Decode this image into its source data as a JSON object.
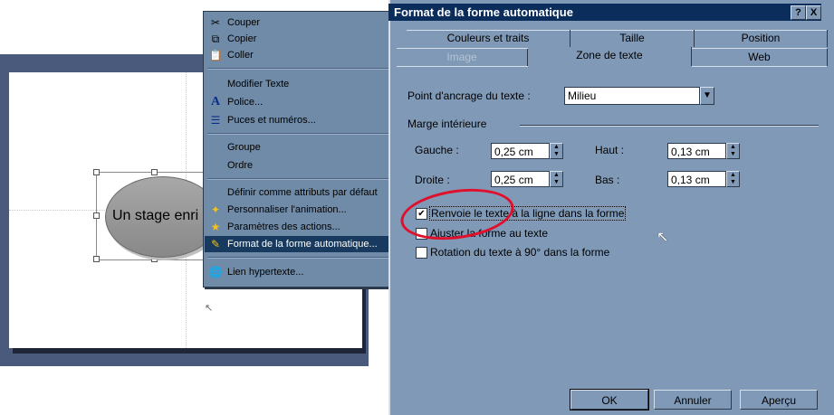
{
  "slide": {
    "shape_text": "Un stage enri"
  },
  "context_menu": {
    "items": [
      {
        "icon": "scissors-icon",
        "glyph": "✂",
        "label": "Couper"
      },
      {
        "icon": "copy-icon",
        "glyph": "⧉",
        "label": "Copier"
      },
      {
        "icon": "paste-icon",
        "glyph": "📋",
        "label": "Coller"
      },
      {
        "icon": "",
        "glyph": "",
        "label": "Modifier Texte"
      },
      {
        "icon": "font-icon",
        "glyph": "A",
        "label": "Police..."
      },
      {
        "icon": "bullets-icon",
        "glyph": "☰",
        "label": "Puces et numéros..."
      },
      {
        "icon": "",
        "glyph": "",
        "label": "Groupe"
      },
      {
        "icon": "",
        "glyph": "",
        "label": "Ordre"
      },
      {
        "icon": "",
        "glyph": "",
        "label": "Définir comme attributs par défaut"
      },
      {
        "icon": "animation-icon",
        "glyph": "✦",
        "label": "Personnaliser l'animation..."
      },
      {
        "icon": "actions-icon",
        "glyph": "★",
        "label": "Paramètres des actions..."
      },
      {
        "icon": "format-shape-icon",
        "glyph": "✎",
        "label": "Format de la forme automatique..."
      },
      {
        "icon": "hyperlink-icon",
        "glyph": "🌐",
        "label": "Lien hypertexte..."
      }
    ]
  },
  "dialog": {
    "title": "Format de la forme automatique",
    "help_label": "?",
    "close_label": "X",
    "tabs": {
      "row1": [
        "Couleurs et traits",
        "Taille",
        "Position"
      ],
      "row2": [
        "Image",
        "Zone de texte",
        "Web"
      ]
    },
    "anchor_label": "Point d'ancrage du texte :",
    "anchor_value": "Milieu",
    "margin_group": "Marge intérieure",
    "left_label": "Gauche :",
    "left_value": "0,25 cm",
    "top_label": "Haut :",
    "top_value": "0,13 cm",
    "right_label": "Droite :",
    "right_value": "0,25 cm",
    "bottom_label": "Bas :",
    "bottom_value": "0,13 cm",
    "checkboxes": [
      {
        "label": "Renvoie le texte à la ligne dans la forme",
        "checked": true
      },
      {
        "label": "Ajuster la forme au texte",
        "checked": false
      },
      {
        "label": "Rotation du texte à 90° dans la forme",
        "checked": false
      }
    ],
    "ok_label": "OK",
    "cancel_label": "Annuler",
    "preview_label": "Aperçu"
  },
  "colors": {
    "dialog_bg": "#7f99b6",
    "titlebar": "#0a2d5c",
    "highlight_circle": "#e0102c"
  }
}
